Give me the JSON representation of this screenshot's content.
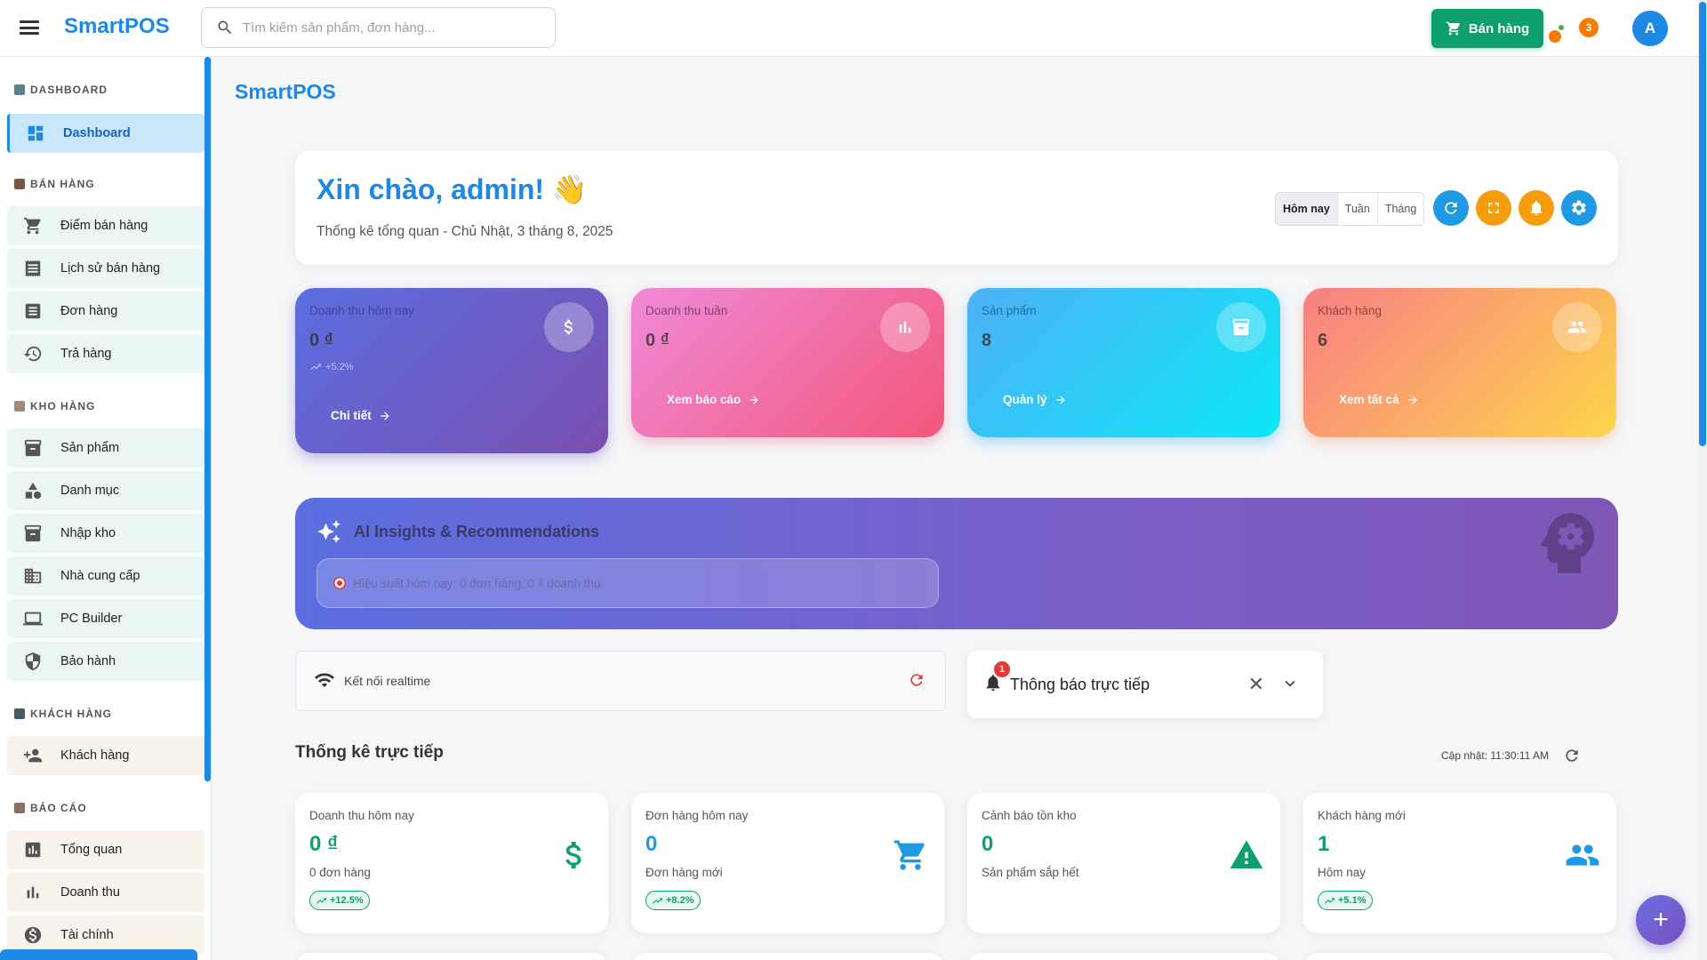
{
  "header": {
    "brand": "SmartPOS",
    "search_placeholder": "Tìm kiếm sản phẩm, đơn hàng...",
    "sell_button": "Bán hàng",
    "notification_count": "3",
    "avatar_initial": "A"
  },
  "sidebar": {
    "sections": [
      {
        "label": "DASHBOARD"
      },
      {
        "label": "BÁN HÀNG"
      },
      {
        "label": "KHO HÀNG"
      },
      {
        "label": "KHÁCH HÀNG"
      },
      {
        "label": "BÁO CÁO"
      }
    ],
    "items": [
      {
        "label": "Dashboard",
        "icon": "dashboard-icon"
      },
      {
        "label": "Điểm bán hàng",
        "icon": "cart-icon"
      },
      {
        "label": "Lịch sử bán hàng",
        "icon": "receipt-icon"
      },
      {
        "label": "Đơn hàng",
        "icon": "list-icon"
      },
      {
        "label": "Trả hàng",
        "icon": "history-icon"
      },
      {
        "label": "Sản phẩm",
        "icon": "archive-icon"
      },
      {
        "label": "Danh mục",
        "icon": "category-icon"
      },
      {
        "label": "Nhập kho",
        "icon": "inbox-icon"
      },
      {
        "label": "Nhà cung cấp",
        "icon": "building-icon"
      },
      {
        "label": "PC Builder",
        "icon": "laptop-icon"
      },
      {
        "label": "Bảo hành",
        "icon": "shield-icon"
      },
      {
        "label": "Khách hàng",
        "icon": "person-add-icon"
      },
      {
        "label": "Tổng quan",
        "icon": "chart-box-icon"
      },
      {
        "label": "Doanh thu",
        "icon": "bar-chart-icon"
      },
      {
        "label": "Tài chính",
        "icon": "dollar-icon"
      }
    ]
  },
  "main": {
    "title": "SmartPOS",
    "greeting": "Xin chào, admin! 👋",
    "subtitle": "Thống kê tổng quan - Chủ Nhật, 3 tháng 8, 2025",
    "periods": [
      "Hôm nay",
      "Tuần",
      "Tháng"
    ],
    "active_period": "Hôm nay"
  },
  "stat_cards": [
    {
      "label": "Doanh thu hôm nay",
      "value": "0 ₫",
      "trend": "+5.2%",
      "link": "Chi tiết",
      "icon": "dollar-icon"
    },
    {
      "label": "Doanh thu tuần",
      "value": "0 ₫",
      "link": "Xem báo cáo",
      "icon": "bar-chart-icon"
    },
    {
      "label": "Sản phẩm",
      "value": "8",
      "link": "Quản lý",
      "icon": "archive-icon"
    },
    {
      "label": "Khách hàng",
      "value": "6",
      "link": "Xem tất cả",
      "icon": "people-icon"
    }
  ],
  "ai": {
    "title": "AI Insights & Recommendations",
    "insight": "Hiệu suất hôm nay: 0 đơn hàng, 0 ₫ doanh thu"
  },
  "realtime": {
    "label": "Kết nối realtime"
  },
  "live_notifications": {
    "title": "Thông báo trực tiếp",
    "badge": "1"
  },
  "live_stats": {
    "title": "Thống kê trực tiếp",
    "updated": "Cập nhật: 11:30:11 AM",
    "cards": [
      {
        "label": "Doanh thu hôm nay",
        "value": "0 ₫",
        "sub": "0 đơn hàng",
        "change": "+12.5%",
        "icon": "dollar-icon"
      },
      {
        "label": "Đơn hàng hôm nay",
        "value": "0",
        "sub": "Đơn hàng mới",
        "change": "+8.2%",
        "icon": "cart-icon"
      },
      {
        "label": "Cảnh báo tồn kho",
        "value": "0",
        "sub": "Sản phẩm sắp hết",
        "change": "",
        "icon": "warning-icon"
      },
      {
        "label": "Khách hàng mới",
        "value": "1",
        "sub": "Hôm nay",
        "change": "+5.1%",
        "icon": "people-icon"
      }
    ]
  },
  "colors": {
    "primary": "#1e88e5",
    "success": "#0e9f6e",
    "danger": "#e53935",
    "warning": "#f59e0b"
  }
}
